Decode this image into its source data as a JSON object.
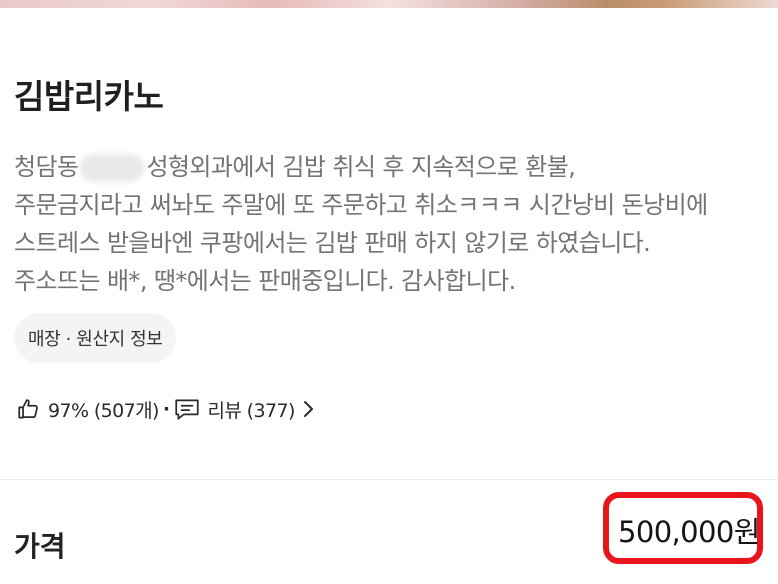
{
  "store": {
    "name": "김밥리카노"
  },
  "description": {
    "line1_before": "청담동",
    "line1_after": "성형외과에서 김밥 취식 후 지속적으로 환불,",
    "line2": "주문금지라고 써놔도 주말에 또 주문하고 취소ㅋㅋㅋ 시간낭비 돈낭비에",
    "line3": "스트레스 받을바엔 쿠팡에서는 김밥 판매 하지 않기로 하였습니다.",
    "line4": "주소뜨는 배*, 땡*에서는 판매중입니다. 감사합니다."
  },
  "info_chip": {
    "label": "매장 · 원산지 정보"
  },
  "stats": {
    "like_icon": "thumbs-up-icon",
    "like_text": "97% (507개)",
    "separator": "·",
    "review_icon": "review-comment-icon",
    "review_text": "리뷰 (377)",
    "chevron_icon": "chevron-right-icon"
  },
  "price": {
    "label": "가격",
    "value": "500,000원",
    "highlight_color": "#e8151b"
  }
}
